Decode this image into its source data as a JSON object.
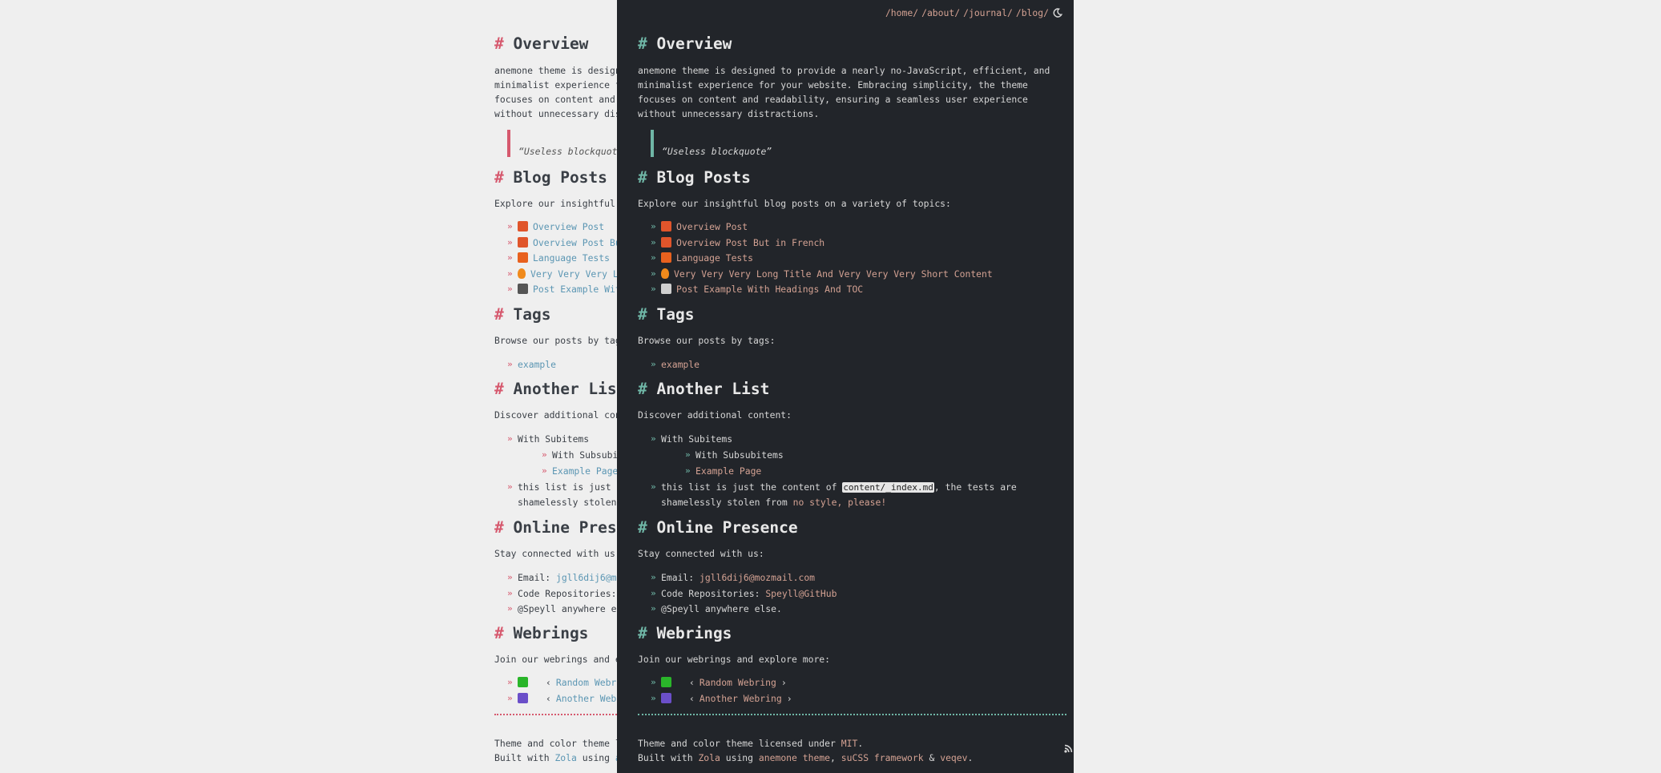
{
  "nav": {
    "links": [
      "/home/",
      "/about/",
      "/journal/",
      "/blog/"
    ],
    "theme_toggle_icon": "moon-icon"
  },
  "overview": {
    "title": "Overview",
    "hash": "#",
    "text": "anemone theme is designed to provide a nearly no-JavaScript, efficient, and minimalist experience for your website. Embracing simplicity, the theme focuses on content and readability, ensuring a seamless user experience without unnecessary distractions.",
    "blockquote": "“Useless blockquote”"
  },
  "blog": {
    "title": "Blog Posts",
    "intro": "Explore our insightful blog posts on a variety of topics:",
    "posts": [
      {
        "icon": "bowl-icon",
        "label": "Overview Post"
      },
      {
        "icon": "bowl-icon",
        "label": "Overview Post But in French"
      },
      {
        "icon": "language-icon",
        "label": "Language Tests"
      },
      {
        "icon": "fire-icon",
        "label": "Very Very Very Long Title And Very Very Very Short Content"
      },
      {
        "icon": "tv-icon",
        "label": "Post Example With Headings And TOC"
      }
    ]
  },
  "tags": {
    "title": "Tags",
    "intro": "Browse our posts by tags:",
    "items": [
      "example"
    ]
  },
  "another": {
    "title": "Another List",
    "intro": "Discover additional content:",
    "item1": "With Subitems",
    "sub1": "With Subsubitems",
    "sub2": "Example Page",
    "item2_pre": "this list is just the content of ",
    "item2_code": "content/_index.md",
    "item2_mid": ", the tests are shamelessly stolen from ",
    "item2_link": "no style, please!"
  },
  "online": {
    "title": "Online Presence",
    "intro": "Stay connected with us:",
    "email_label": "Email: ",
    "email": "jgll6dij6@mozmail.com",
    "repo_label": "Code Repositories: ",
    "repo": "Speyll@GitHub",
    "else": "@Speyll anywhere else."
  },
  "webrings": {
    "title": "Webrings",
    "intro": "Join our webrings and explore more:",
    "rings": [
      {
        "icon": "webring-green-icon",
        "prev": "‹",
        "label": "Random Webring",
        "next": "›"
      },
      {
        "icon": "webring-music-icon",
        "prev": "‹",
        "label": "Another Webring",
        "next": "›"
      }
    ]
  },
  "footer": {
    "line1_pre": "Theme and color theme licensed under ",
    "line1_link": "MIT",
    "line1_post": ".",
    "line2_pre": "Built with ",
    "zola": "Zola",
    "using": " using ",
    "anemone": "anemone theme",
    "comma": ", ",
    "sucss": "suCSS framework",
    "amp": " & ",
    "veqev": "veqev",
    "end": "."
  },
  "colors": {
    "light_bg": "#efefef",
    "dark_bg": "#22252a",
    "light_accent": "#d6596e",
    "dark_accent": "#6fb6a6",
    "light_link": "#5b96b3",
    "dark_link": "#d4a293"
  }
}
